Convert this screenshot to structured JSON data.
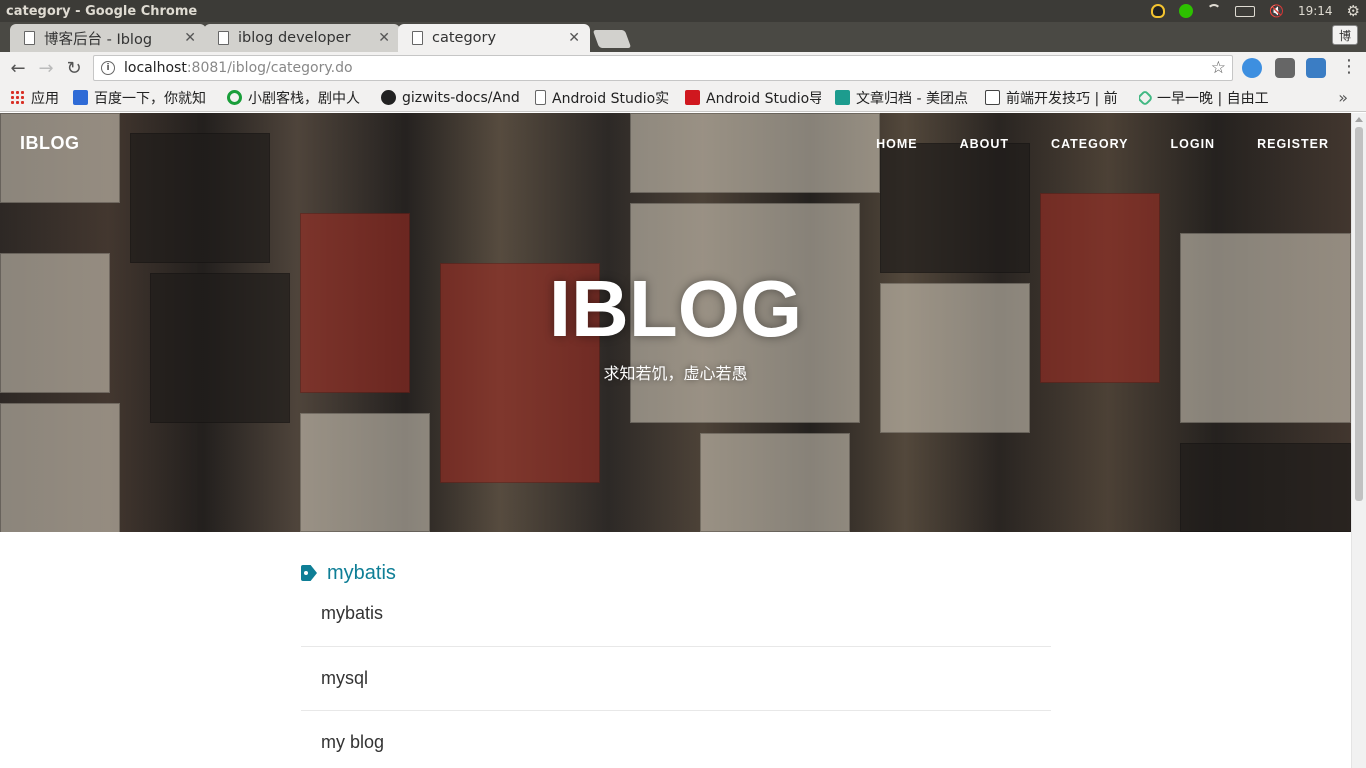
{
  "window": {
    "title": "category - Google Chrome"
  },
  "tray": {
    "time": "19:14",
    "ime": "博"
  },
  "tabs": [
    {
      "label": "博客后台 - Iblog"
    },
    {
      "label": "iblog developer"
    },
    {
      "label": "category"
    }
  ],
  "omnibox": {
    "host": "localhost",
    "path": ":8081/iblog/category.do"
  },
  "bookmarks": [
    {
      "label": "应用",
      "icon": "apps-grid-icon"
    },
    {
      "label": "百度一下，你就知",
      "icon": "baidu-paw-icon"
    },
    {
      "label": "小剧客栈，剧中人",
      "icon": "drama-icon"
    },
    {
      "label": "gizwits-docs/And",
      "icon": "github-icon"
    },
    {
      "label": "Android Studio实",
      "icon": "file-icon"
    },
    {
      "label": "Android Studio导",
      "icon": "csdn-icon"
    },
    {
      "label": "文章归档 - 美团点",
      "icon": "meituan-icon"
    },
    {
      "label": "前端开发技巧 | 前",
      "icon": "book-icon"
    },
    {
      "label": "一早一晚 | 自由工",
      "icon": "vue-icon"
    }
  ],
  "site": {
    "brand": "IBLOG",
    "nav": [
      "HOME",
      "ABOUT",
      "CATEGORY",
      "LOGIN",
      "REGISTER"
    ],
    "hero_title": "IBLOG",
    "hero_subtitle": "求知若饥，虚心若愚"
  },
  "category": {
    "heading": "mybatis",
    "items": [
      "mybatis",
      "mysql",
      "my blog"
    ]
  },
  "colors": {
    "accent": "#0e7e96",
    "titlebar": "#3c3b37"
  }
}
